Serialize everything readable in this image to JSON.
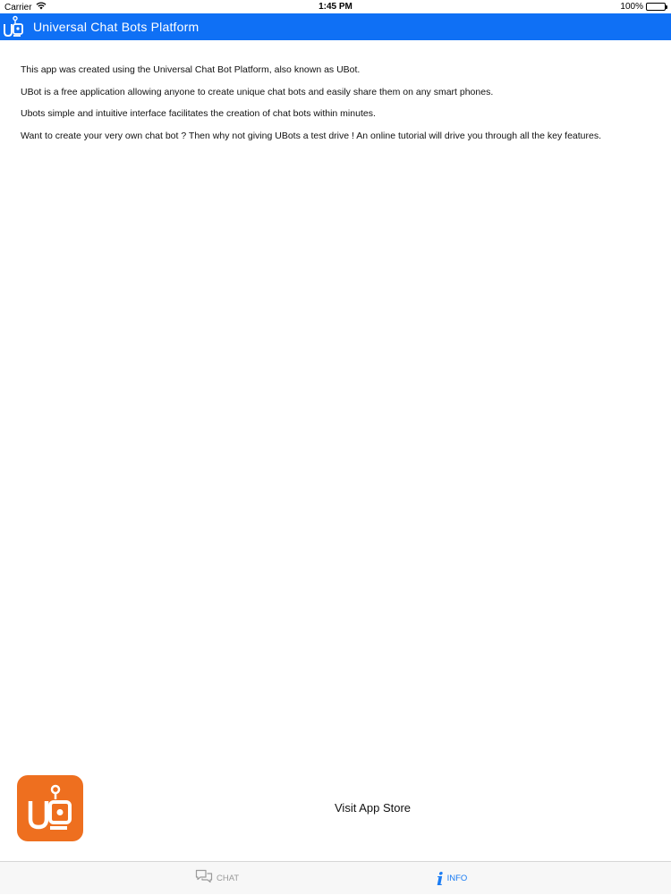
{
  "status_bar": {
    "carrier": "Carrier",
    "time": "1:45 PM",
    "battery": "100%",
    "battery_level": 1.0,
    "wifi_icon": "wifi-icon"
  },
  "nav": {
    "title": "Universal Chat Bots Platform",
    "logo_icon": "ubot-logo-icon",
    "color": "#0f70f5"
  },
  "content": {
    "paragraphs": [
      "This app was created using the Universal Chat Bot Platform, also known as UBot.",
      "UBot is a free application allowing anyone to create unique chat bots and easily share them on any smart phones.",
      "Ubots simple and intuitive interface facilitates the creation of chat bots within minutes.",
      "Want to create your very own chat bot ? Then why not giving UBots a test drive ! An online tutorial will drive you through all the key features."
    ]
  },
  "footer": {
    "app_icon": "ubot-app-icon",
    "app_icon_color": "#ee6f1f",
    "visit_label": "Visit App Store"
  },
  "tabs": [
    {
      "label": "CHAT",
      "icon": "chat-bubbles-icon",
      "active": false
    },
    {
      "label": "INFO",
      "icon": "info-icon",
      "active": true
    }
  ]
}
